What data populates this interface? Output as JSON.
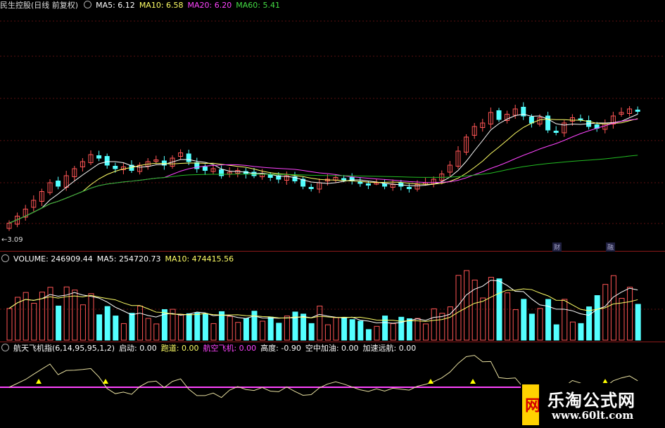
{
  "main_legend": {
    "title": "民生控股(日线 前复权)",
    "ma5": "MA5: 6.12",
    "ma10": "MA10: 6.58",
    "ma20": "MA20: 6.20",
    "ma60": "MA60: 5.41",
    "low_label": "3.09",
    "mark1": "财",
    "mark2": "融"
  },
  "volume_legend": {
    "label": "VOLUME: 246909.44",
    "ma5": "MA5: 254720.73",
    "ma10": "MA10: 474415.56"
  },
  "indicator_legend": {
    "name": "航天飞机指(6,14,95,95,1,2)",
    "start": "启动: 0.00",
    "runway": "跑道: 0.00",
    "aircraft": "航空飞机: 0.00",
    "altitude": "高度: -0.90",
    "refuel": "空中加油: 0.00",
    "accel": "加速远航: 0.00"
  },
  "watermark": {
    "logo": "网",
    "title": "乐淘公式网",
    "url": "www.60lt.com"
  },
  "colors": {
    "up": "#ff5555",
    "down": "#54ffff",
    "ma5": "#ffffff",
    "ma10": "#ffff66",
    "ma20": "#ff44ff",
    "ma60": "#22bb22",
    "separator": "#8b1a1a"
  },
  "chart_data": {
    "type": "candlestick",
    "bars": 78,
    "closes": [
      3.35,
      3.55,
      3.75,
      4.0,
      4.25,
      4.5,
      4.4,
      4.7,
      4.9,
      5.1,
      5.3,
      5.2,
      5.0,
      4.9,
      4.95,
      4.85,
      5.0,
      5.1,
      5.15,
      5.0,
      5.2,
      5.35,
      5.1,
      4.9,
      4.85,
      4.9,
      4.7,
      4.8,
      4.85,
      4.75,
      4.7,
      4.75,
      4.65,
      4.6,
      4.7,
      4.55,
      4.4,
      4.35,
      4.5,
      4.6,
      4.65,
      4.6,
      4.55,
      4.5,
      4.45,
      4.5,
      4.4,
      4.45,
      4.4,
      4.35,
      4.45,
      4.5,
      4.6,
      4.75,
      5.0,
      5.4,
      5.8,
      6.1,
      6.2,
      6.5,
      6.3,
      6.45,
      6.6,
      6.4,
      6.2,
      6.35,
      6.0,
      5.95,
      6.2,
      6.35,
      6.3,
      6.1,
      6.05,
      6.2,
      6.4,
      6.5,
      6.6,
      6.55
    ],
    "ma5": 6.12,
    "ma10": 6.58,
    "ma20": 6.2,
    "ma60": 5.41,
    "low": 3.09,
    "volume": 246909.44,
    "volume_ma5": 254720.73,
    "volume_ma10": 474415.56
  }
}
